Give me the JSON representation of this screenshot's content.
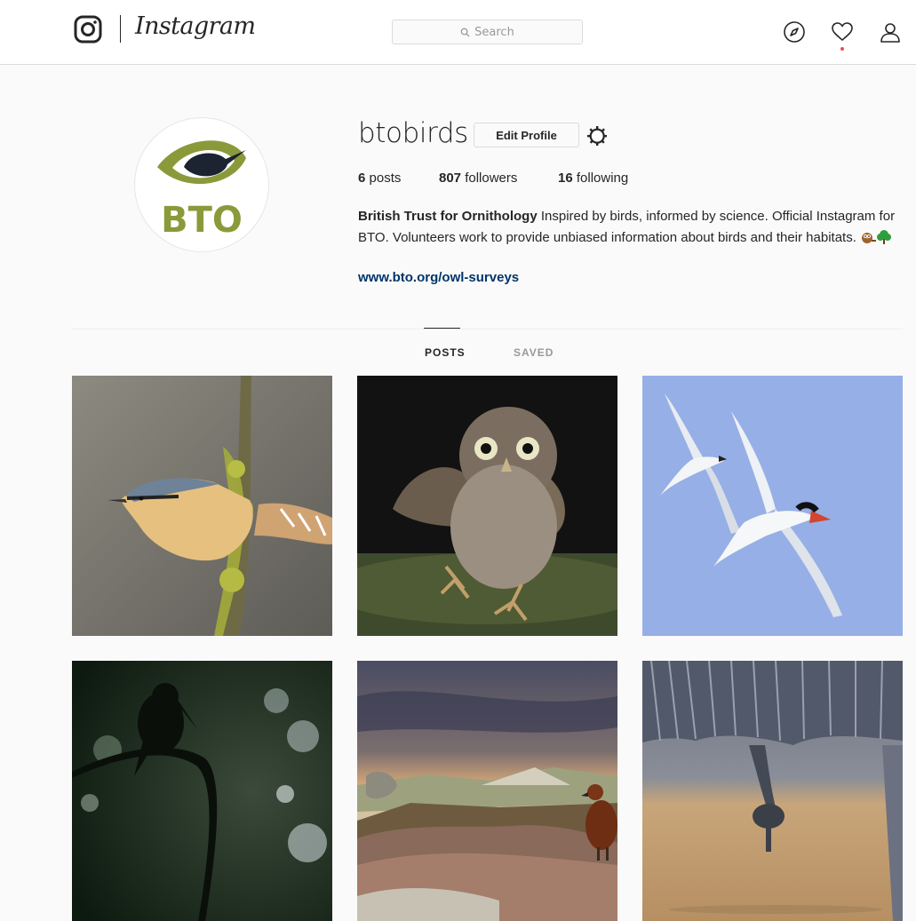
{
  "nav": {
    "wordmark": "Instagram",
    "search_placeholder": "Search"
  },
  "profile": {
    "username": "btobirds",
    "edit_label": "Edit Profile",
    "avatar_text": "BTO",
    "stats": {
      "posts_count": "6",
      "posts_label": "posts",
      "followers_count": "807",
      "followers_label": "followers",
      "following_count": "16",
      "following_label": "following"
    },
    "bio": {
      "full_name": "British Trust for Ornithology",
      "text": " Inspired by birds, informed by science. Official Instagram for BTO. Volunteers work to provide unbiased information about birds and their habitats. ",
      "link": "www.bto.org/owl-surveys"
    }
  },
  "tabs": {
    "posts": "POSTS",
    "saved": "SAVED"
  },
  "posts": [
    {
      "subject": "nuthatch on mossy branch"
    },
    {
      "subject": "little owl landing"
    },
    {
      "subject": "two terns in flight"
    },
    {
      "subject": "kingfisher silhouette"
    },
    {
      "subject": "grouse on moorland at sunset"
    },
    {
      "subject": "heron wing close-up"
    }
  ],
  "colors": {
    "link": "#003569",
    "bto_green": "#8a9a3a",
    "notification": "#ed4956"
  }
}
